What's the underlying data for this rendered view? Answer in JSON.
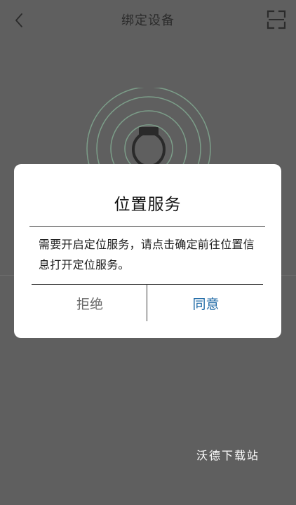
{
  "header": {
    "title": "绑定设备"
  },
  "icons": {
    "back": "chevron-left-icon",
    "scan": "scan-frame-icon"
  },
  "dialog": {
    "title": "位置服务",
    "message": "需要开启定位服务，请点击确定前往位置信息打开定位服务。",
    "buttons": {
      "reject": "拒绝",
      "agree": "同意"
    }
  },
  "watermark": "沃德下载站",
  "colors": {
    "overlay": "#5f5f5f",
    "dialog_bg": "#ffffff",
    "agree": "#1f6aa6",
    "reject": "#676767",
    "radar_rings": "#7c9e89"
  }
}
